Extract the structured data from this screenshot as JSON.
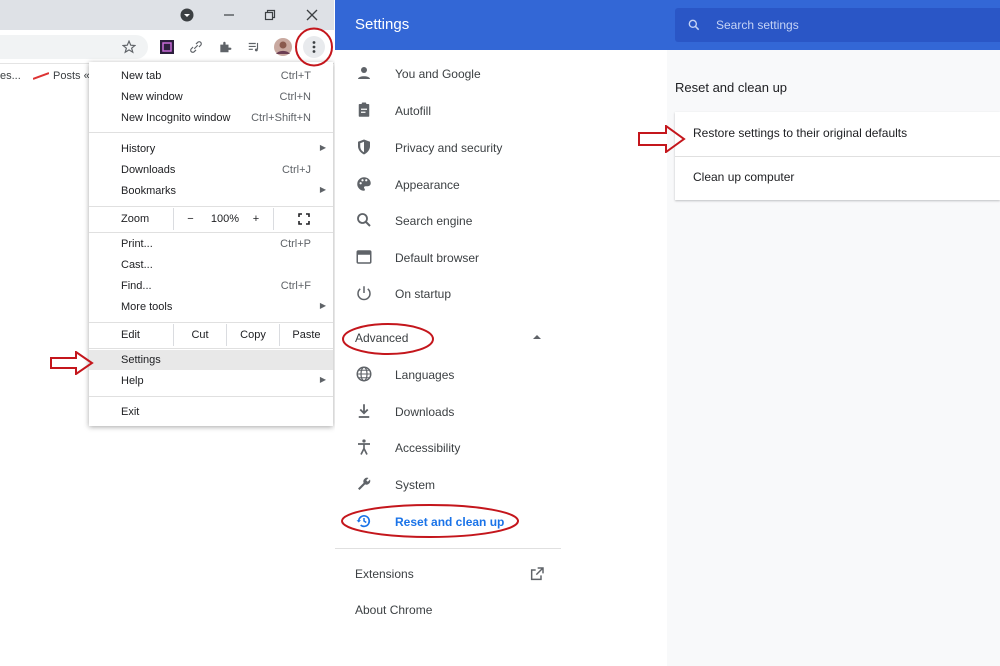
{
  "browser": {
    "bookmarks": [
      "es...",
      "Posts «"
    ],
    "menu": {
      "items": [
        {
          "label": "New tab",
          "shortcut": "Ctrl+T"
        },
        {
          "label": "New window",
          "shortcut": "Ctrl+N"
        },
        {
          "label": "New Incognito window",
          "shortcut": "Ctrl+Shift+N"
        },
        {
          "label": "History"
        },
        {
          "label": "Downloads",
          "shortcut": "Ctrl+J"
        },
        {
          "label": "Bookmarks"
        },
        {
          "label": "Print...",
          "shortcut": "Ctrl+P"
        },
        {
          "label": "Cast..."
        },
        {
          "label": "Find...",
          "shortcut": "Ctrl+F"
        },
        {
          "label": "More tools"
        },
        {
          "label": "Settings"
        },
        {
          "label": "Help"
        },
        {
          "label": "Exit"
        }
      ],
      "zoom": {
        "label": "Zoom",
        "minus": "−",
        "value": "100%",
        "plus": "+"
      },
      "edit": {
        "label": "Edit",
        "cut": "Cut",
        "copy": "Copy",
        "paste": "Paste"
      }
    }
  },
  "settings": {
    "title": "Settings",
    "search_placeholder": "Search settings",
    "nav": [
      {
        "label": "You and Google",
        "icon": "person-icon"
      },
      {
        "label": "Autofill",
        "icon": "clipboard-icon"
      },
      {
        "label": "Privacy and security",
        "icon": "shield-icon"
      },
      {
        "label": "Appearance",
        "icon": "palette-icon"
      },
      {
        "label": "Search engine",
        "icon": "search-icon"
      },
      {
        "label": "Default browser",
        "icon": "browser-window-icon"
      },
      {
        "label": "On startup",
        "icon": "power-icon"
      }
    ],
    "advanced_label": "Advanced",
    "advanced_nav": [
      {
        "label": "Languages",
        "icon": "globe-icon"
      },
      {
        "label": "Downloads",
        "icon": "download-icon"
      },
      {
        "label": "Accessibility",
        "icon": "accessibility-icon"
      },
      {
        "label": "System",
        "icon": "wrench-icon"
      },
      {
        "label": "Reset and clean up",
        "icon": "restore-icon"
      }
    ],
    "footer": {
      "extensions": "Extensions",
      "about": "About Chrome"
    },
    "section_title": "Reset and clean up",
    "options": [
      "Restore settings to their original defaults",
      "Clean up computer"
    ]
  },
  "colors": {
    "header": "#3367d6",
    "accent": "#1a73e8",
    "annotation": "#c4161c"
  }
}
